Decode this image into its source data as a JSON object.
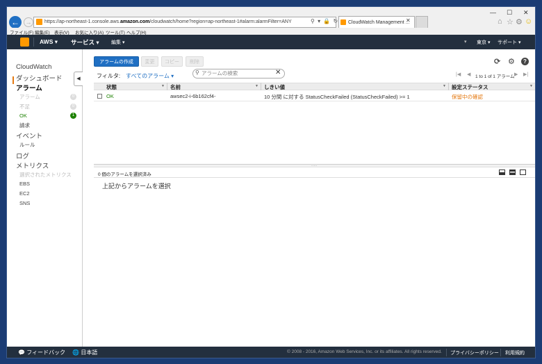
{
  "browser": {
    "url_prefix": "https://ap-northeast-1.console.aws.",
    "url_domain": "amazon.com",
    "url_rest": "/cloudwatch/home?region=ap-northeast-1#alarm:alarmFilter=ANY",
    "tab_title": "CloudWatch Management ...",
    "menu": [
      "ファイル(F)",
      "編集(E)",
      "表示(V)",
      "お気に入り(A)",
      "ツール(T)",
      "ヘルプ(H)"
    ]
  },
  "aws_nav": {
    "brand": "AWS",
    "services": "サービス",
    "edit": "編集",
    "region": "東京",
    "support": "サポート"
  },
  "sidebar": {
    "title": "CloudWatch",
    "dashboard": "ダッシュボード",
    "alarms": "アラーム",
    "alarm_state_alarm": "アラーム",
    "alarm_state_insufficient": "不足",
    "alarm_state_ok": "OK",
    "billing": "請求",
    "events": "イベント",
    "rules": "ルール",
    "logs": "ログ",
    "metrics": "メトリクス",
    "selected_metrics": "選択されたメトリクス",
    "ebs": "EBS",
    "ec2": "EC2",
    "sns": "SNS",
    "count_alarm": "0",
    "count_insufficient": "0",
    "count_ok": "1"
  },
  "toolbar": {
    "create": "アラームの作成",
    "modify": "変更",
    "copy": "コピー",
    "delete": "削除"
  },
  "filter": {
    "label": "フィルタ:",
    "value": "すべてのアラーム",
    "search_placeholder": "アラームの検索",
    "pager": "1 to 1 of 1 アラーム"
  },
  "table": {
    "headers": [
      "状態",
      "名前",
      "しきい値",
      "設定ステータス"
    ],
    "rows": [
      {
        "state": "OK",
        "name": "awsec2-i-6b162cf4-",
        "threshold": "10 分間 に対する StatusCheckFailed (StatusCheckFailed) >= 1",
        "config": "保留中の確認"
      }
    ]
  },
  "details": {
    "selected_count": "0 個のアラームを選択済み",
    "empty_message": "上記からアラームを選択"
  },
  "footer": {
    "feedback": "フィードバック",
    "language": "日本語",
    "copyright": "© 2008 - 2016, Amazon Web Services, Inc. or its affiliates. All rights reserved.",
    "privacy": "プライバシーポリシー",
    "terms": "利用規約"
  }
}
